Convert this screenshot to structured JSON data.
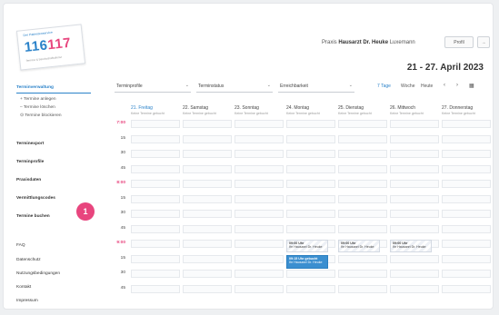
{
  "header": {
    "logo_tagline": "Der Patientenservice",
    "logo_number": "116117",
    "logo_sub": "Termine & Bereitschaftsdienst",
    "practice_prefix": "Praxis",
    "practice_name": "Hausarzt Dr. Heuke",
    "practice_user": "Luxemann",
    "profile_btn": "Profil",
    "logout_btn": "→",
    "week_title": "21 - 27. April 2023"
  },
  "sidebar": {
    "items": [
      {
        "label": "Terminverwaltung",
        "style": "active"
      },
      {
        "label": "+ Termine anlegen",
        "style": "sub"
      },
      {
        "label": "– Termine löschen",
        "style": "sub"
      },
      {
        "label": "⊙ Termine blockieren",
        "style": "sub"
      },
      {
        "label": "Terminexport",
        "style": "bold"
      },
      {
        "label": "Terminprofile",
        "style": "bold"
      },
      {
        "label": "Praxisdaten",
        "style": "bold"
      },
      {
        "label": "Vermittlungscodes",
        "style": "bold"
      },
      {
        "label": "Termine buchen",
        "style": "bold"
      },
      {
        "label": "FAQ",
        "style": "plain"
      },
      {
        "label": "Datenschutz",
        "style": "plain"
      },
      {
        "label": "Nutzungsbedingungen",
        "style": "plain"
      },
      {
        "label": "Kontakt",
        "style": "plain"
      },
      {
        "label": "Impressum",
        "style": "plain"
      }
    ],
    "badge": "1"
  },
  "filters": [
    {
      "label": "Terminprofile"
    },
    {
      "label": "Terminstatus"
    },
    {
      "label": "Erreichbarkeit"
    }
  ],
  "view": {
    "options": [
      "7 Tage",
      "Woche",
      "Heute"
    ],
    "active": "7 Tage",
    "prev": "‹",
    "next": "›",
    "calendar_icon": "▦"
  },
  "calendar": {
    "days": [
      {
        "label": "21. Freitag",
        "sub": "Keine Termine gebucht",
        "today": true
      },
      {
        "label": "22. Samstag",
        "sub": "Keine Termine gebucht",
        "today": false
      },
      {
        "label": "23. Sonntag",
        "sub": "Keine Termine gebucht",
        "today": false
      },
      {
        "label": "24. Montag",
        "sub": "Keine Termine gebucht",
        "today": false
      },
      {
        "label": "25. Dienstag",
        "sub": "Keine Termine gebucht",
        "today": false
      },
      {
        "label": "26. Mittwoch",
        "sub": "Keine Termine gebucht",
        "today": false
      },
      {
        "label": "27. Donnerstag",
        "sub": "Keine Termine gebucht",
        "today": false
      }
    ],
    "times": [
      {
        "label": "7:00",
        "hour": true
      },
      {
        "label": "15",
        "hour": false
      },
      {
        "label": "30",
        "hour": false
      },
      {
        "label": "45",
        "hour": false
      },
      {
        "label": "8:00",
        "hour": true
      },
      {
        "label": "15",
        "hour": false
      },
      {
        "label": "30",
        "hour": false
      },
      {
        "label": "45",
        "hour": false
      },
      {
        "label": "9:00",
        "hour": true
      },
      {
        "label": "15",
        "hour": false
      },
      {
        "label": "30",
        "hour": false
      },
      {
        "label": "45",
        "hour": false
      }
    ],
    "events": [
      {
        "day": 3,
        "slot": 8,
        "title": "09:00 Uhr",
        "text": "Ihr Hausarzt Dr. Heuke",
        "style": "hatched"
      },
      {
        "day": 3,
        "slot": 9,
        "title": "09:15 Uhr gebucht",
        "text": "Ihr Hausarzt Dr. Heuke",
        "style": "blue"
      },
      {
        "day": 4,
        "slot": 8,
        "title": "09:00 Uhr",
        "text": "Ihr Hausarzt Dr. Heuke",
        "style": "hatched"
      },
      {
        "day": 5,
        "slot": 8,
        "title": "09:00 Uhr",
        "text": "Ihr Hausarzt Dr. Heuke",
        "style": "hatched"
      }
    ]
  },
  "colors": {
    "accent": "#2a82c9",
    "pink": "#e8457e"
  }
}
